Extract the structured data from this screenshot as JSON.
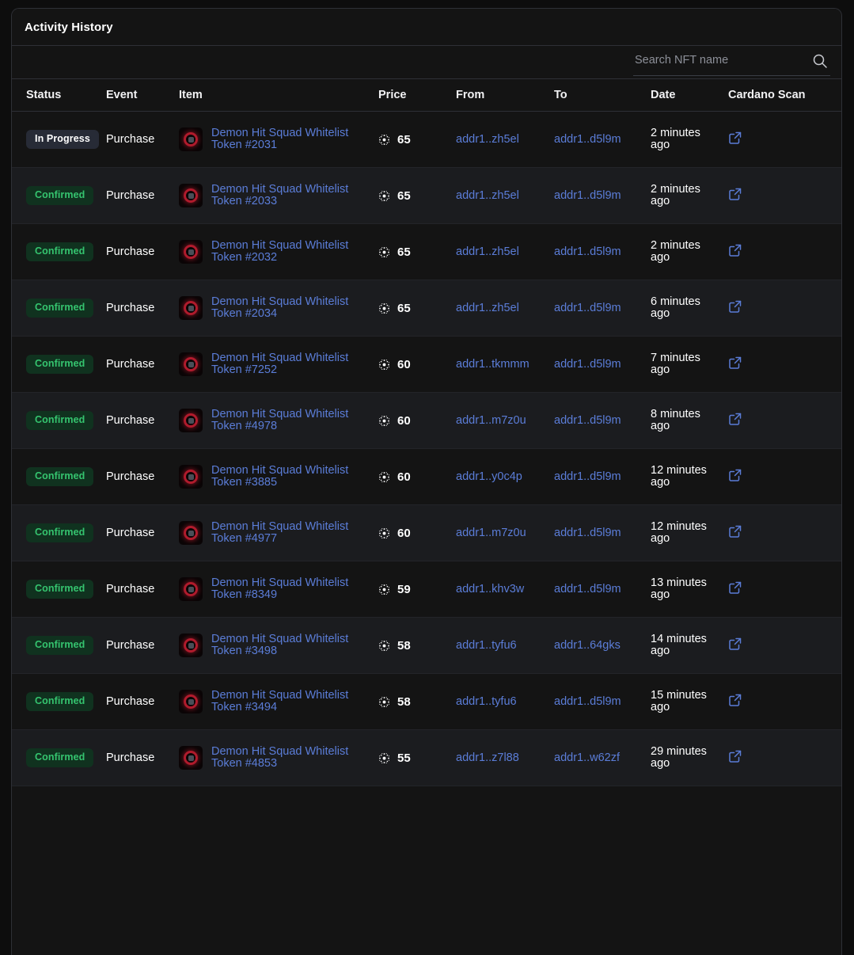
{
  "panel": {
    "title": "Activity History"
  },
  "search": {
    "placeholder": "Search NFT name",
    "value": "",
    "icon": "search-icon"
  },
  "table": {
    "columns": [
      "Status",
      "Event",
      "Item",
      "Price",
      "From",
      "To",
      "Date",
      "Cardano Scan"
    ],
    "icons": {
      "currency": "ada-icon",
      "external_link": "external-link-icon",
      "thumbnail": "nft-thumbnail-icon"
    },
    "rows": [
      {
        "status": "In Progress",
        "status_type": "progress",
        "event": "Purchase",
        "item": "Demon Hit Squad Whitelist Token #2031",
        "price": "65",
        "from": "addr1..zh5el",
        "to": "addr1..d5l9m",
        "date": "2 minutes ago"
      },
      {
        "status": "Confirmed",
        "status_type": "confirmed",
        "event": "Purchase",
        "item": "Demon Hit Squad Whitelist Token #2033",
        "price": "65",
        "from": "addr1..zh5el",
        "to": "addr1..d5l9m",
        "date": "2 minutes ago"
      },
      {
        "status": "Confirmed",
        "status_type": "confirmed",
        "event": "Purchase",
        "item": "Demon Hit Squad Whitelist Token #2032",
        "price": "65",
        "from": "addr1..zh5el",
        "to": "addr1..d5l9m",
        "date": "2 minutes ago"
      },
      {
        "status": "Confirmed",
        "status_type": "confirmed",
        "event": "Purchase",
        "item": "Demon Hit Squad Whitelist Token #2034",
        "price": "65",
        "from": "addr1..zh5el",
        "to": "addr1..d5l9m",
        "date": "6 minutes ago"
      },
      {
        "status": "Confirmed",
        "status_type": "confirmed",
        "event": "Purchase",
        "item": "Demon Hit Squad Whitelist Token #7252",
        "price": "60",
        "from": "addr1..tkmmm",
        "to": "addr1..d5l9m",
        "date": "7 minutes ago"
      },
      {
        "status": "Confirmed",
        "status_type": "confirmed",
        "event": "Purchase",
        "item": "Demon Hit Squad Whitelist Token #4978",
        "price": "60",
        "from": "addr1..m7z0u",
        "to": "addr1..d5l9m",
        "date": "8 minutes ago"
      },
      {
        "status": "Confirmed",
        "status_type": "confirmed",
        "event": "Purchase",
        "item": "Demon Hit Squad Whitelist Token #3885",
        "price": "60",
        "from": "addr1..y0c4p",
        "to": "addr1..d5l9m",
        "date": "12 minutes ago"
      },
      {
        "status": "Confirmed",
        "status_type": "confirmed",
        "event": "Purchase",
        "item": "Demon Hit Squad Whitelist Token #4977",
        "price": "60",
        "from": "addr1..m7z0u",
        "to": "addr1..d5l9m",
        "date": "12 minutes ago"
      },
      {
        "status": "Confirmed",
        "status_type": "confirmed",
        "event": "Purchase",
        "item": "Demon Hit Squad Whitelist Token #8349",
        "price": "59",
        "from": "addr1..khv3w",
        "to": "addr1..d5l9m",
        "date": "13 minutes ago"
      },
      {
        "status": "Confirmed",
        "status_type": "confirmed",
        "event": "Purchase",
        "item": "Demon Hit Squad Whitelist Token #3498",
        "price": "58",
        "from": "addr1..tyfu6",
        "to": "addr1..64gks",
        "date": "14 minutes ago"
      },
      {
        "status": "Confirmed",
        "status_type": "confirmed",
        "event": "Purchase",
        "item": "Demon Hit Squad Whitelist Token #3494",
        "price": "58",
        "from": "addr1..tyfu6",
        "to": "addr1..d5l9m",
        "date": "15 minutes ago"
      },
      {
        "status": "Confirmed",
        "status_type": "confirmed",
        "event": "Purchase",
        "item": "Demon Hit Squad Whitelist Token #4853",
        "price": "55",
        "from": "addr1..z7l88",
        "to": "addr1..w62zf",
        "date": "29 minutes ago"
      }
    ]
  },
  "colors": {
    "page_background": "#0d0d0d",
    "panel_background": "#141414",
    "row_alt_background": "#1b1c1f",
    "border": "#2e3036",
    "link": "#5b7dd8",
    "confirmed_text": "#35c46f",
    "confirmed_background": "#10321f",
    "progress_background": "#272b36",
    "text_primary": "#ffffff"
  }
}
